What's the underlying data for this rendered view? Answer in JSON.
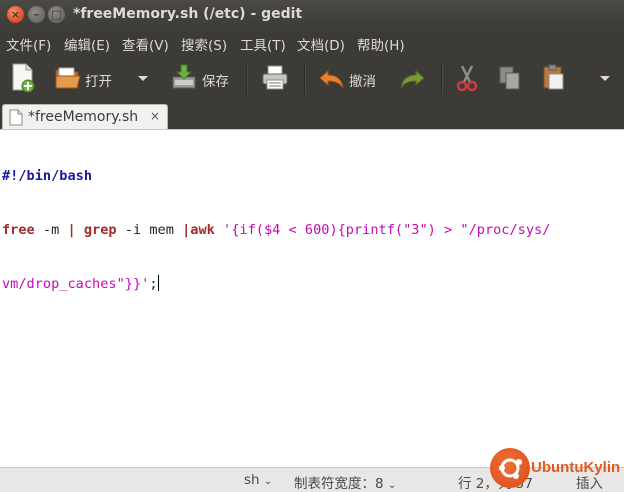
{
  "window": {
    "title": "*freeMemory.sh (/etc) - gedit"
  },
  "menubar": {
    "items": [
      "文件(F)",
      "编辑(E)",
      "查看(V)",
      "搜索(S)",
      "工具(T)",
      "文档(D)",
      "帮助(H)"
    ]
  },
  "toolbar": {
    "new_icon": "new-document-icon",
    "open_label": "打开",
    "save_label": "保存",
    "print_icon": "print-icon",
    "undo_label": "撤消",
    "redo_icon": "redo-icon",
    "cut_icon": "cut-icon",
    "copy_icon": "copy-icon",
    "paste_icon": "paste-icon",
    "overflow_icon": "dropdown-icon"
  },
  "tab": {
    "label": "*freeMemory.sh",
    "close": "×"
  },
  "editor": {
    "line1": "#!/bin/bash",
    "line2_cmd": "free",
    "line2_a": " -m ",
    "line2_pipe1": "|",
    "line2_b": " ",
    "line2_grep": "grep",
    "line2_c": " -i mem ",
    "line2_pipe2": "|",
    "line2_awk": "awk",
    "line2_d": " ",
    "line2_str": "'{if($4 < 600){printf(\"3\") > \"/proc/sys/",
    "line3_str": "vm/drop_caches\"}}'",
    "line3_end": ";"
  },
  "statusbar": {
    "language": "sh",
    "tab_width": "制表符宽度：8",
    "position": "行 2，列 57",
    "mode": "插入"
  },
  "watermark": {
    "text": "UbuntuKylin"
  },
  "colors": {
    "chrome": "#3c3b37",
    "shebang": "#1a1a9e",
    "keyword": "#a52a2a",
    "string": "#c40ab8",
    "watermark": "#e35a20"
  }
}
